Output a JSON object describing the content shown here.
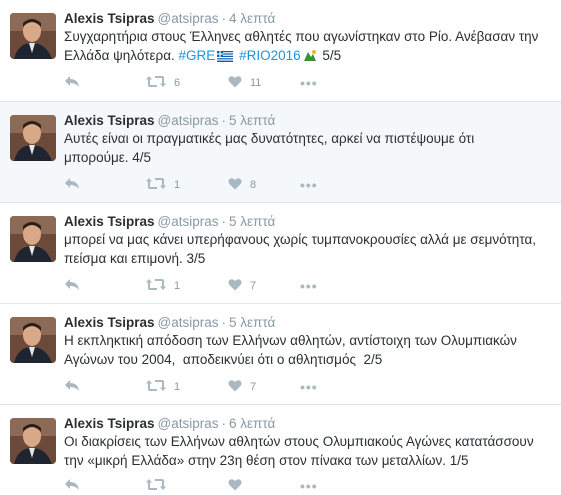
{
  "tweets": [
    {
      "name": "Alexis Tsipras",
      "handle": "@atsipras",
      "time": "4 λεπτά",
      "text_lines": [
        "Συγχαρητήρια στους Έλληνες αθλητές που αγωνίστηκαν στο Ρίο. Ανέβασαν την",
        "Ελλάδα ψηλότερα."
      ],
      "hashtag1": "#GRE",
      "hashtag2": "#RIO2016",
      "suffix": "5/5",
      "retweets": "6",
      "likes": "11"
    },
    {
      "name": "Alexis Tsipras",
      "handle": "@atsipras",
      "time": "5 λεπτά",
      "text_lines": [
        "Αυτές είναι οι πραγματικές μας δυνατότητες, αρκεί να πιστέψουμε ότι",
        "μπορούμε. 4/5"
      ],
      "retweets": "1",
      "likes": "8"
    },
    {
      "name": "Alexis Tsipras",
      "handle": "@atsipras",
      "time": "5 λεπτά",
      "text_lines": [
        "μπορεί να μας κάνει υπερήφανους χωρίς τυμπανοκρουσίες αλλά με σεμνότητα,",
        "πείσμα και επιμονή. 3/5"
      ],
      "retweets": "1",
      "likes": "7"
    },
    {
      "name": "Alexis Tsipras",
      "handle": "@atsipras",
      "time": "5 λεπτά",
      "text_lines": [
        "Η εκπληκτική απόδοση των Ελλήνων αθλητών, αντίστοιχη των Ολυμπιακών",
        "Αγώνων του 2004,  αποδεικνύει ότι ο αθλητισμός  2/5"
      ],
      "retweets": "1",
      "likes": "7"
    },
    {
      "name": "Alexis Tsipras",
      "handle": "@atsipras",
      "time": "6 λεπτά",
      "text_lines": [
        "Οι διακρίσεις των Ελλήνων αθλητών στους Ολυμπιακούς Αγώνες κατατάσσουν",
        "την «μικρή Ελλάδα» στην 23η θέση στον πίνακα των μεταλλίων. 1/5"
      ],
      "retweets": "",
      "likes": ""
    }
  ],
  "colors": {
    "link": "#1b95e0",
    "muted": "#8899a6",
    "icon": "#aab8c2",
    "highlight_bg": "#f5f8fa",
    "border": "#e1e8ed"
  },
  "icons": [
    "reply-icon",
    "retweet-icon",
    "heart-icon",
    "more-icon",
    "greek-flag-icon",
    "medal-icon"
  ]
}
